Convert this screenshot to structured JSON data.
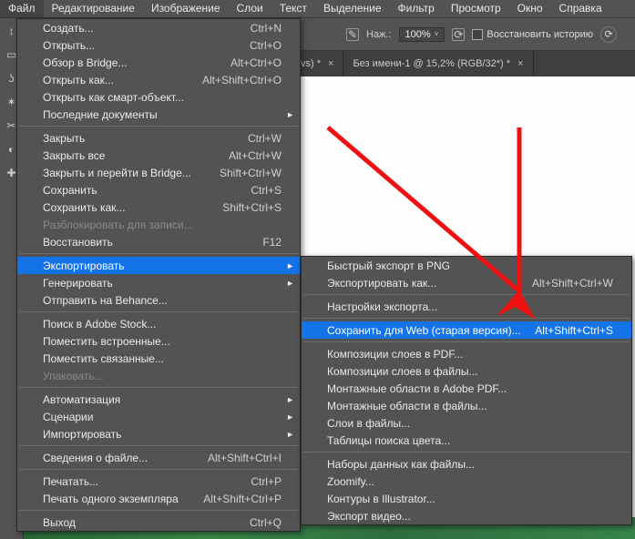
{
  "menubar": {
    "items": [
      "Файл",
      "Редактирование",
      "Изображение",
      "Слои",
      "Текст",
      "Выделение",
      "Фильтр",
      "Просмотр",
      "Окно",
      "Справка"
    ],
    "open_index": 0
  },
  "options": {
    "mode_label": "Наж.:",
    "mode_value": "100%",
    "restore_history": "Восстановить историю"
  },
  "tabs": [
    {
      "title": "vs) *"
    },
    {
      "title": "Без имени-1 @ 15,2% (RGB/32*) *"
    }
  ],
  "file_menu": [
    {
      "label": "Создать...",
      "shortcut": "Ctrl+N"
    },
    {
      "label": "Открыть...",
      "shortcut": "Ctrl+O"
    },
    {
      "label": "Обзор в Bridge...",
      "shortcut": "Alt+Ctrl+O"
    },
    {
      "label": "Открыть как...",
      "shortcut": "Alt+Shift+Ctrl+O"
    },
    {
      "label": "Открыть как смарт-объект..."
    },
    {
      "label": "Последние документы",
      "submenu": true
    },
    {
      "sep": true
    },
    {
      "label": "Закрыть",
      "shortcut": "Ctrl+W"
    },
    {
      "label": "Закрыть все",
      "shortcut": "Alt+Ctrl+W"
    },
    {
      "label": "Закрыть и перейти в Bridge...",
      "shortcut": "Shift+Ctrl+W"
    },
    {
      "label": "Сохранить",
      "shortcut": "Ctrl+S"
    },
    {
      "label": "Сохранить как...",
      "shortcut": "Shift+Ctrl+S"
    },
    {
      "label": "Разблокировать для записи...",
      "disabled": true
    },
    {
      "label": "Восстановить",
      "shortcut": "F12"
    },
    {
      "sep": true
    },
    {
      "label": "Экспортировать",
      "submenu": true,
      "highlight": true
    },
    {
      "label": "Генерировать",
      "submenu": true
    },
    {
      "label": "Отправить на Behance..."
    },
    {
      "sep": true
    },
    {
      "label": "Поиск в Adobe Stock..."
    },
    {
      "label": "Поместить встроенные..."
    },
    {
      "label": "Поместить связанные..."
    },
    {
      "label": "Упаковать...",
      "disabled": true
    },
    {
      "sep": true
    },
    {
      "label": "Автоматизация",
      "submenu": true
    },
    {
      "label": "Сценарии",
      "submenu": true
    },
    {
      "label": "Импортировать",
      "submenu": true
    },
    {
      "sep": true
    },
    {
      "label": "Сведения о файле...",
      "shortcut": "Alt+Shift+Ctrl+I"
    },
    {
      "sep": true
    },
    {
      "label": "Печатать...",
      "shortcut": "Ctrl+P"
    },
    {
      "label": "Печать одного экземпляра",
      "shortcut": "Alt+Shift+Ctrl+P"
    },
    {
      "sep": true
    },
    {
      "label": "Выход",
      "shortcut": "Ctrl+Q"
    }
  ],
  "export_menu": [
    {
      "label": "Быстрый экспорт в PNG"
    },
    {
      "label": "Экспортировать как...",
      "shortcut": "Alt+Shift+Ctrl+W"
    },
    {
      "sep": true
    },
    {
      "label": "Настройки экспорта..."
    },
    {
      "sep": true
    },
    {
      "label": "Сохранить для Web (старая версия)...",
      "shortcut": "Alt+Shift+Ctrl+S",
      "highlight": true
    },
    {
      "sep": true
    },
    {
      "label": "Композиции слоев в PDF..."
    },
    {
      "label": "Композиции слоев в файлы..."
    },
    {
      "label": "Монтажные области в Adobe PDF..."
    },
    {
      "label": "Монтажные области в файлы..."
    },
    {
      "label": "Слои в файлы..."
    },
    {
      "label": "Таблицы поиска цвета..."
    },
    {
      "sep": true
    },
    {
      "label": "Наборы данных как файлы..."
    },
    {
      "label": "Zoomify..."
    },
    {
      "label": "Контуры в Illustrator..."
    },
    {
      "label": "Экспорт видео..."
    }
  ]
}
